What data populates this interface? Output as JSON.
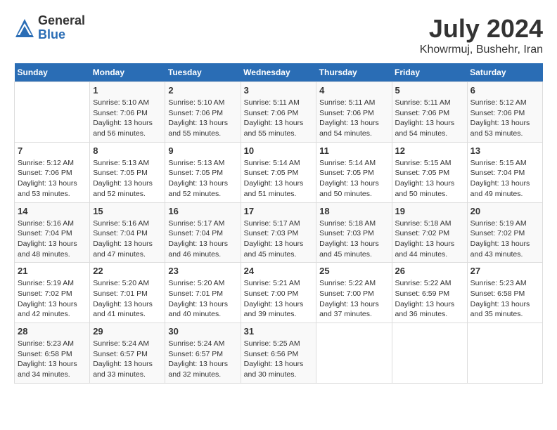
{
  "header": {
    "logo_general": "General",
    "logo_blue": "Blue",
    "month_title": "July 2024",
    "location": "Khowrmuj, Bushehr, Iran"
  },
  "days_of_week": [
    "Sunday",
    "Monday",
    "Tuesday",
    "Wednesday",
    "Thursday",
    "Friday",
    "Saturday"
  ],
  "weeks": [
    [
      {
        "day": "",
        "info": ""
      },
      {
        "day": "1",
        "info": "Sunrise: 5:10 AM\nSunset: 7:06 PM\nDaylight: 13 hours\nand 56 minutes."
      },
      {
        "day": "2",
        "info": "Sunrise: 5:10 AM\nSunset: 7:06 PM\nDaylight: 13 hours\nand 55 minutes."
      },
      {
        "day": "3",
        "info": "Sunrise: 5:11 AM\nSunset: 7:06 PM\nDaylight: 13 hours\nand 55 minutes."
      },
      {
        "day": "4",
        "info": "Sunrise: 5:11 AM\nSunset: 7:06 PM\nDaylight: 13 hours\nand 54 minutes."
      },
      {
        "day": "5",
        "info": "Sunrise: 5:11 AM\nSunset: 7:06 PM\nDaylight: 13 hours\nand 54 minutes."
      },
      {
        "day": "6",
        "info": "Sunrise: 5:12 AM\nSunset: 7:06 PM\nDaylight: 13 hours\nand 53 minutes."
      }
    ],
    [
      {
        "day": "7",
        "info": "Sunrise: 5:12 AM\nSunset: 7:06 PM\nDaylight: 13 hours\nand 53 minutes."
      },
      {
        "day": "8",
        "info": "Sunrise: 5:13 AM\nSunset: 7:05 PM\nDaylight: 13 hours\nand 52 minutes."
      },
      {
        "day": "9",
        "info": "Sunrise: 5:13 AM\nSunset: 7:05 PM\nDaylight: 13 hours\nand 52 minutes."
      },
      {
        "day": "10",
        "info": "Sunrise: 5:14 AM\nSunset: 7:05 PM\nDaylight: 13 hours\nand 51 minutes."
      },
      {
        "day": "11",
        "info": "Sunrise: 5:14 AM\nSunset: 7:05 PM\nDaylight: 13 hours\nand 50 minutes."
      },
      {
        "day": "12",
        "info": "Sunrise: 5:15 AM\nSunset: 7:05 PM\nDaylight: 13 hours\nand 50 minutes."
      },
      {
        "day": "13",
        "info": "Sunrise: 5:15 AM\nSunset: 7:04 PM\nDaylight: 13 hours\nand 49 minutes."
      }
    ],
    [
      {
        "day": "14",
        "info": "Sunrise: 5:16 AM\nSunset: 7:04 PM\nDaylight: 13 hours\nand 48 minutes."
      },
      {
        "day": "15",
        "info": "Sunrise: 5:16 AM\nSunset: 7:04 PM\nDaylight: 13 hours\nand 47 minutes."
      },
      {
        "day": "16",
        "info": "Sunrise: 5:17 AM\nSunset: 7:04 PM\nDaylight: 13 hours\nand 46 minutes."
      },
      {
        "day": "17",
        "info": "Sunrise: 5:17 AM\nSunset: 7:03 PM\nDaylight: 13 hours\nand 45 minutes."
      },
      {
        "day": "18",
        "info": "Sunrise: 5:18 AM\nSunset: 7:03 PM\nDaylight: 13 hours\nand 45 minutes."
      },
      {
        "day": "19",
        "info": "Sunrise: 5:18 AM\nSunset: 7:02 PM\nDaylight: 13 hours\nand 44 minutes."
      },
      {
        "day": "20",
        "info": "Sunrise: 5:19 AM\nSunset: 7:02 PM\nDaylight: 13 hours\nand 43 minutes."
      }
    ],
    [
      {
        "day": "21",
        "info": "Sunrise: 5:19 AM\nSunset: 7:02 PM\nDaylight: 13 hours\nand 42 minutes."
      },
      {
        "day": "22",
        "info": "Sunrise: 5:20 AM\nSunset: 7:01 PM\nDaylight: 13 hours\nand 41 minutes."
      },
      {
        "day": "23",
        "info": "Sunrise: 5:20 AM\nSunset: 7:01 PM\nDaylight: 13 hours\nand 40 minutes."
      },
      {
        "day": "24",
        "info": "Sunrise: 5:21 AM\nSunset: 7:00 PM\nDaylight: 13 hours\nand 39 minutes."
      },
      {
        "day": "25",
        "info": "Sunrise: 5:22 AM\nSunset: 7:00 PM\nDaylight: 13 hours\nand 37 minutes."
      },
      {
        "day": "26",
        "info": "Sunrise: 5:22 AM\nSunset: 6:59 PM\nDaylight: 13 hours\nand 36 minutes."
      },
      {
        "day": "27",
        "info": "Sunrise: 5:23 AM\nSunset: 6:58 PM\nDaylight: 13 hours\nand 35 minutes."
      }
    ],
    [
      {
        "day": "28",
        "info": "Sunrise: 5:23 AM\nSunset: 6:58 PM\nDaylight: 13 hours\nand 34 minutes."
      },
      {
        "day": "29",
        "info": "Sunrise: 5:24 AM\nSunset: 6:57 PM\nDaylight: 13 hours\nand 33 minutes."
      },
      {
        "day": "30",
        "info": "Sunrise: 5:24 AM\nSunset: 6:57 PM\nDaylight: 13 hours\nand 32 minutes."
      },
      {
        "day": "31",
        "info": "Sunrise: 5:25 AM\nSunset: 6:56 PM\nDaylight: 13 hours\nand 30 minutes."
      },
      {
        "day": "",
        "info": ""
      },
      {
        "day": "",
        "info": ""
      },
      {
        "day": "",
        "info": ""
      }
    ]
  ]
}
